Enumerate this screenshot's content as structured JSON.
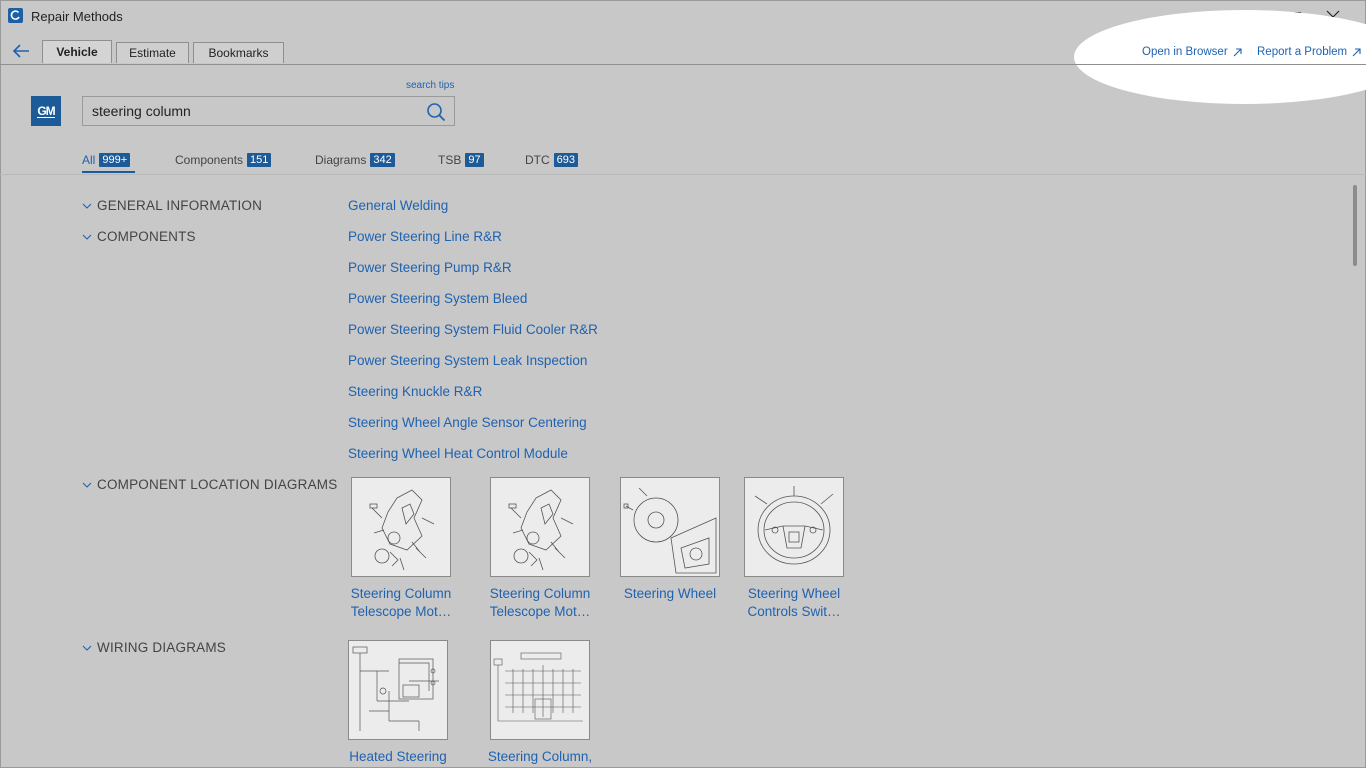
{
  "window": {
    "title": "Repair Methods"
  },
  "tabs": [
    {
      "label": "Vehicle",
      "active": true
    },
    {
      "label": "Estimate",
      "active": false
    },
    {
      "label": "Bookmarks",
      "active": false
    }
  ],
  "top_links": {
    "open_browser": "Open in Browser",
    "report_problem": "Report a Problem"
  },
  "brand": {
    "logo_text": "GM",
    "color": "#1d5a98"
  },
  "search": {
    "tips": "search tips",
    "value": "steering column"
  },
  "filters": [
    {
      "label": "All",
      "count": "999+",
      "active": true
    },
    {
      "label": "Components",
      "count": "151",
      "active": false
    },
    {
      "label": "Diagrams",
      "count": "342",
      "active": false
    },
    {
      "label": "TSB",
      "count": "97",
      "active": false
    },
    {
      "label": "DTC",
      "count": "693",
      "active": false
    }
  ],
  "sections": {
    "general": "GENERAL INFORMATION",
    "components": "COMPONENTS",
    "location": "COMPONENT LOCATION DIAGRAMS",
    "wiring": "WIRING DIAGRAMS"
  },
  "links": [
    "General Welding",
    "Power Steering Line R&R",
    "Power Steering Pump R&R",
    "Power Steering System Bleed",
    "Power Steering System Fluid Cooler R&R",
    "Power Steering System Leak Inspection",
    "Steering Knuckle R&R",
    "Steering Wheel Angle Sensor Centering",
    "Steering Wheel Heat Control Module"
  ],
  "location_diagrams": [
    {
      "caption_1": "Steering Column",
      "caption_2": "Telescope Mot…"
    },
    {
      "caption_1": "Steering Column",
      "caption_2": "Telescope Mot…"
    },
    {
      "caption_1": "Steering Wheel",
      "caption_2": ""
    },
    {
      "caption_1": "Steering Wheel",
      "caption_2": "Controls Swit…"
    }
  ],
  "wiring_diagrams": [
    {
      "caption_1": "Heated Steering"
    },
    {
      "caption_1": "Steering Column,"
    }
  ],
  "colors": {
    "link": "#1f62b0",
    "badge": "#1d5a98",
    "background": "#c8c8c8"
  }
}
